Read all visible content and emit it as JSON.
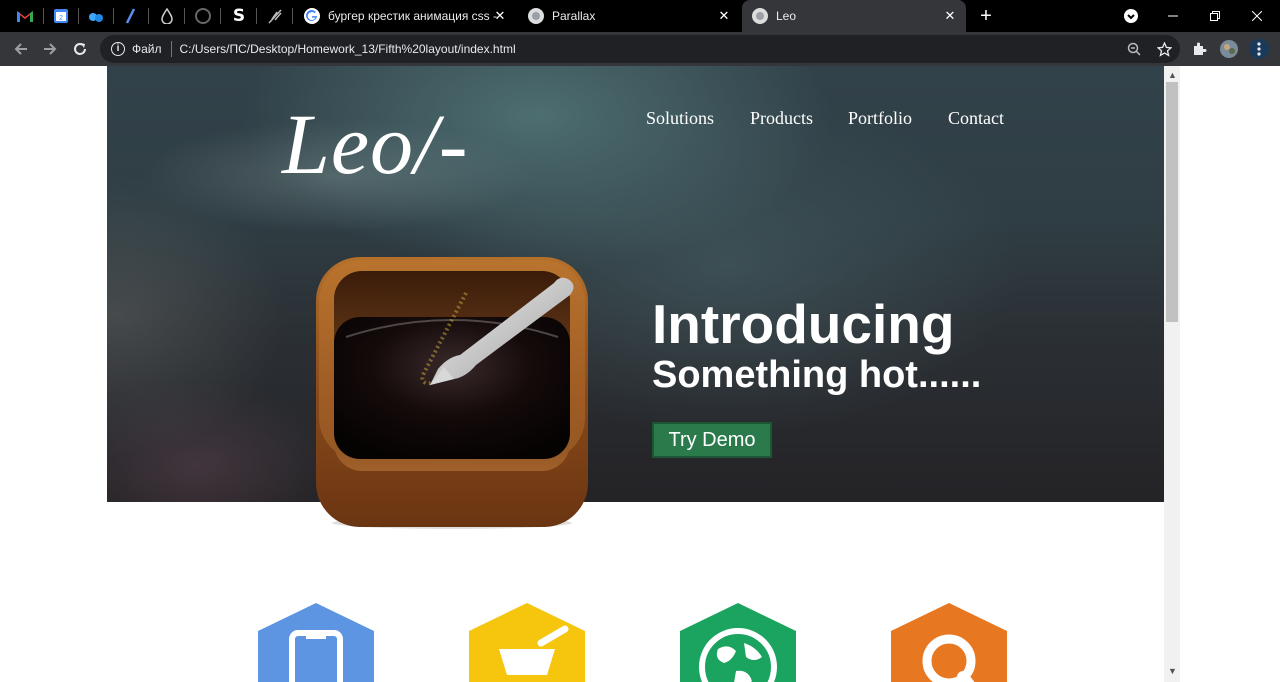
{
  "browser": {
    "tabs": [
      {
        "title": "бургер крестик анимация css - ",
        "active": false
      },
      {
        "title": "Parallax",
        "active": false
      },
      {
        "title": "Leo",
        "active": true
      }
    ],
    "address": {
      "file_label": "Файл",
      "url": "C:/Users/ПС/Desktop/Homework_13/Fifth%20layout/index.html"
    },
    "pinned_letter": "S"
  },
  "page": {
    "logo": "Leo/-",
    "nav": [
      "Solutions",
      "Products",
      "Portfolio",
      "Contact"
    ],
    "hero": {
      "title": "Introducing",
      "subtitle": "Something hot......",
      "cta": "Try Demo"
    },
    "features": [
      {
        "icon": "phone-icon",
        "color": "#5e95e3"
      },
      {
        "icon": "mortar-icon",
        "color": "#f6c50e"
      },
      {
        "icon": "globe-icon",
        "color": "#1aa460"
      },
      {
        "icon": "search-icon",
        "color": "#e87722"
      }
    ]
  }
}
